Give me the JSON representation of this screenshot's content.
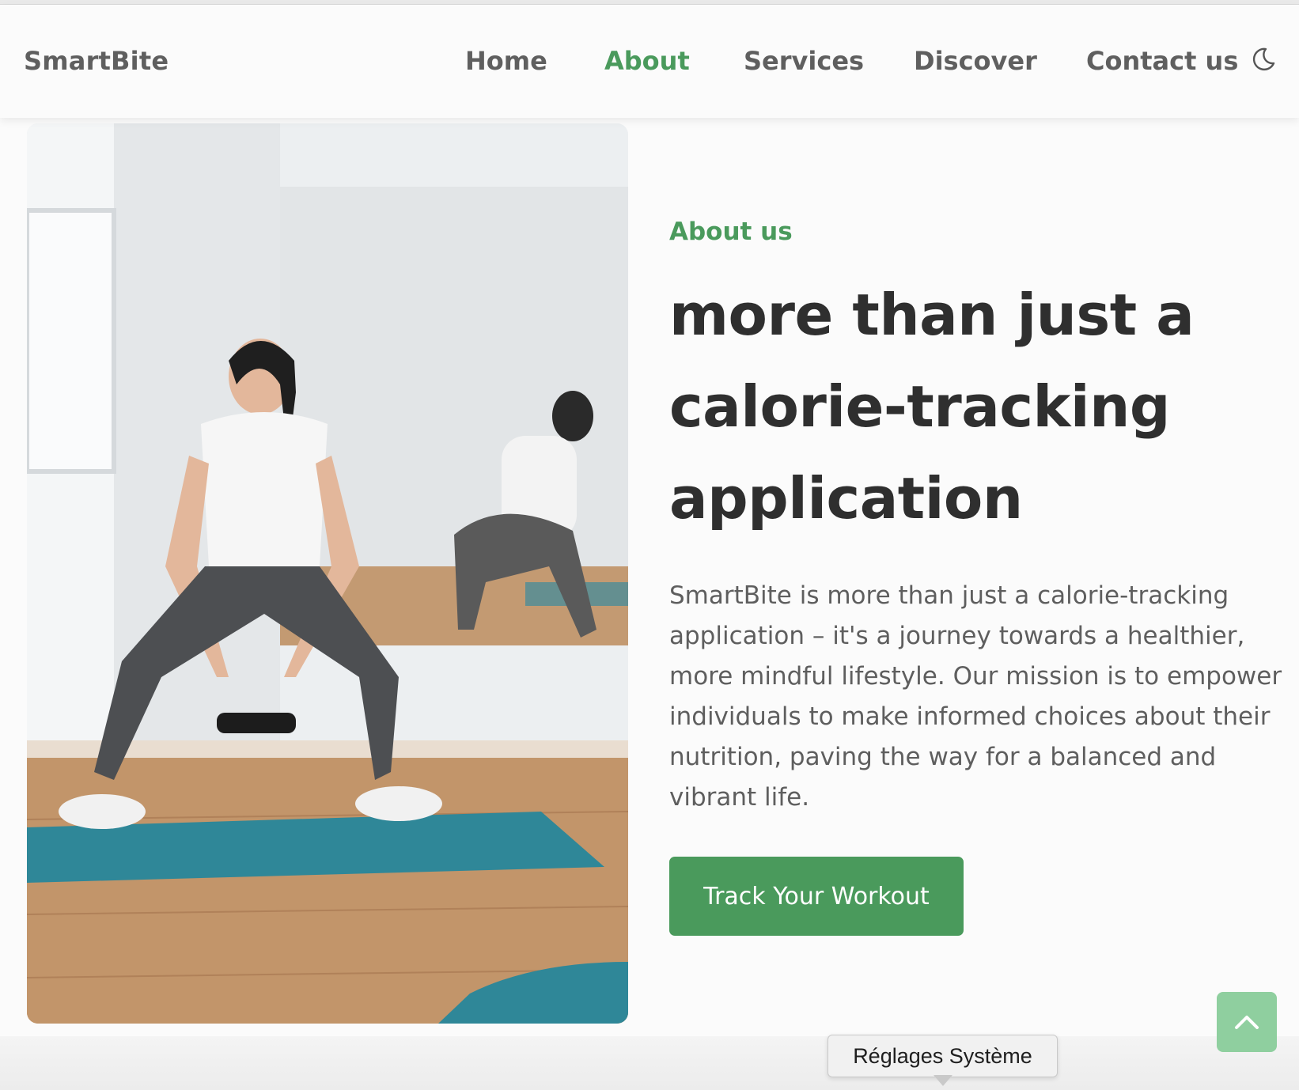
{
  "header": {
    "logo": "SmartBite",
    "nav": [
      {
        "label": "Home",
        "active": false
      },
      {
        "label": "About",
        "active": true
      },
      {
        "label": "Services",
        "active": false
      },
      {
        "label": "Discover",
        "active": false
      },
      {
        "label": "Contact us",
        "active": false
      }
    ],
    "theme_toggle_icon": "moon-icon"
  },
  "about": {
    "eyebrow": "About us",
    "headline": "more than just a calorie-tracking application",
    "description": "SmartBite is more than just a calorie-tracking application – it's a journey towards a healthier, more mindful lifestyle. Our mission is to empower individuals to make informed choices about their nutrition, paving the way for a balanced and vibrant life.",
    "cta_label": "Track Your Workout",
    "image_icon": "fitness-photo"
  },
  "scroll_top_icon": "chevron-up-icon",
  "tooltip": {
    "label": "Réglages Système"
  },
  "colors": {
    "accent": "#4a9a5c",
    "scroll_button": "#8fcf9f",
    "heading": "#2f2f2f",
    "body_text": "#5e5e5e"
  }
}
